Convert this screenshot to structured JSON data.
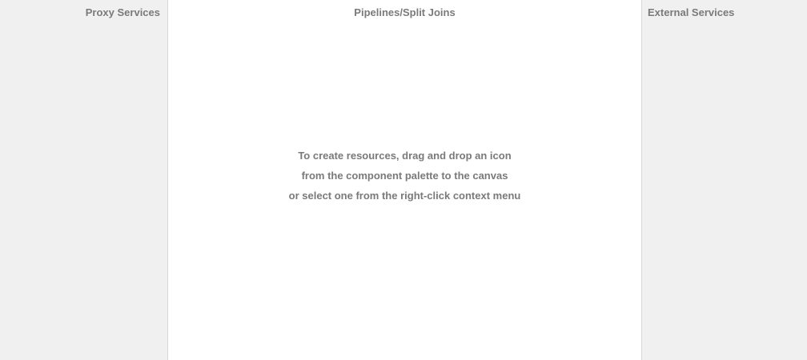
{
  "lanes": {
    "proxy_services": {
      "title": "Proxy Services"
    },
    "pipelines": {
      "title": "Pipelines/Split Joins"
    },
    "external_services": {
      "title": "External Services"
    }
  },
  "canvas_hint": {
    "line1": "To create resources, drag and drop an icon",
    "line2": "from the component palette to the canvas",
    "line3": "or select one from the right-click context menu"
  }
}
